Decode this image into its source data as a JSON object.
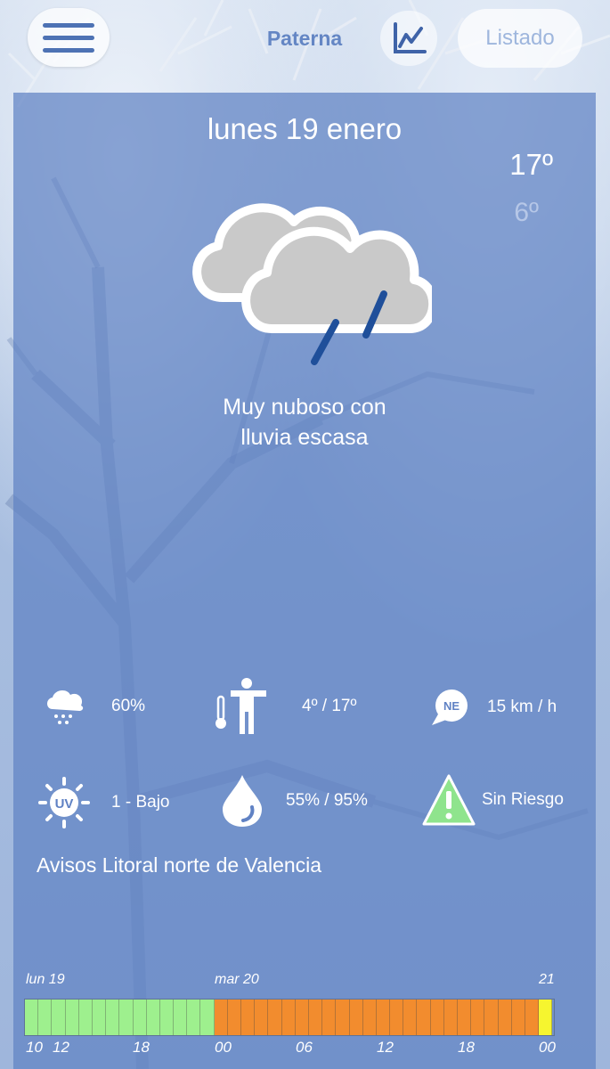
{
  "header": {
    "menu_icon": "hamburger-menu-icon",
    "city": "Paterna",
    "chart_icon": "line-chart-icon",
    "list_button": "Listado"
  },
  "forecast": {
    "date": "lunes 19 enero",
    "temp_max": "17º",
    "temp_min": "6º",
    "icon": "cloudy-rain-icon",
    "description_line1": "Muy nuboso con",
    "description_line2": "lluvia escasa"
  },
  "stats": [
    {
      "icon": "rain-cloud-icon",
      "label": "precipitation-probability",
      "value": "60%"
    },
    {
      "icon": "thermal-sensation-icon",
      "label": "thermal-sensation",
      "value": "4º / 17º"
    },
    {
      "icon": "wind-direction-icon",
      "label": "wind",
      "badge": "NE",
      "value": "15 km / h"
    },
    {
      "icon": "uv-sun-icon",
      "label": "uv-index",
      "badge": "UV",
      "value": "1 - Bajo"
    },
    {
      "icon": "humidity-drop-icon",
      "label": "humidity",
      "value": "55% / 95%"
    },
    {
      "icon": "warning-triangle-icon",
      "label": "risk-level",
      "value": "Sin Riesgo"
    }
  ],
  "avisos": "Avisos Litoral norte de Valencia",
  "timeline": {
    "days": [
      "lun 19",
      "mar 20",
      "21"
    ],
    "hours": [
      "10",
      "12",
      "18",
      "00",
      "06",
      "12",
      "18",
      "00"
    ],
    "colors": {
      "green": "#9ef08e",
      "orange": "#f28c2e",
      "yellow": "#f6f52f"
    },
    "segments_green": 14,
    "segments_orange": 24,
    "segments_yellow": 1
  }
}
